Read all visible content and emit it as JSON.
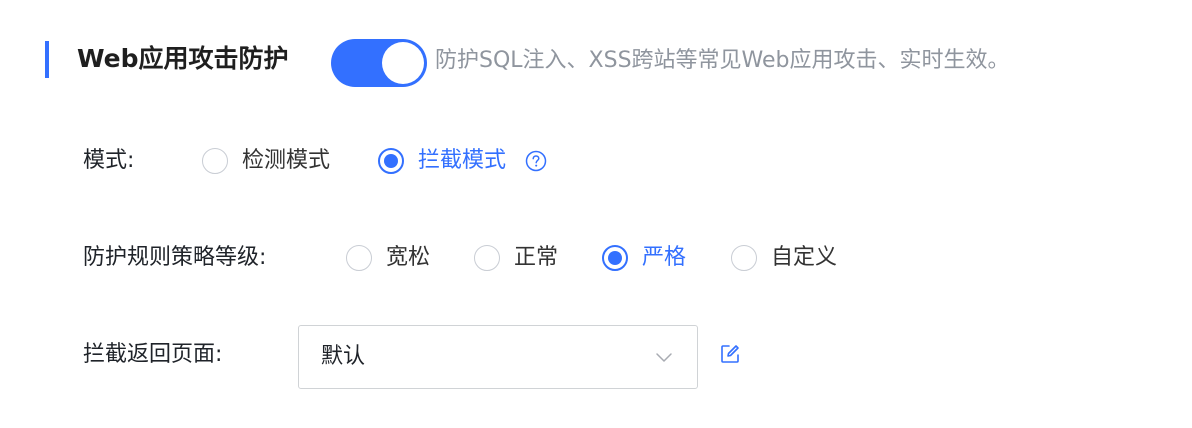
{
  "section": {
    "title": "Web应用攻击防护",
    "toggle_on": true,
    "description": "防护SQL注入、XSS跨站等常见Web应用攻击、实时生效。"
  },
  "mode": {
    "label": "模式:",
    "options": [
      {
        "label": "检测模式",
        "checked": false
      },
      {
        "label": "拦截模式",
        "checked": true
      }
    ],
    "help_icon": "question-circle-icon"
  },
  "rule_level": {
    "label": "防护规则策略等级:",
    "options": [
      {
        "label": "宽松",
        "checked": false
      },
      {
        "label": "正常",
        "checked": false
      },
      {
        "label": "严格",
        "checked": true
      },
      {
        "label": "自定义",
        "checked": false
      }
    ]
  },
  "block_page": {
    "label": "拦截返回页面:",
    "selected": "默认",
    "arrow_icon": "chevron-down-icon",
    "edit_icon": "edit-icon"
  },
  "colors": {
    "accent": "#3370ff",
    "muted_text": "#8f959e",
    "border": "#d0d3d6"
  }
}
